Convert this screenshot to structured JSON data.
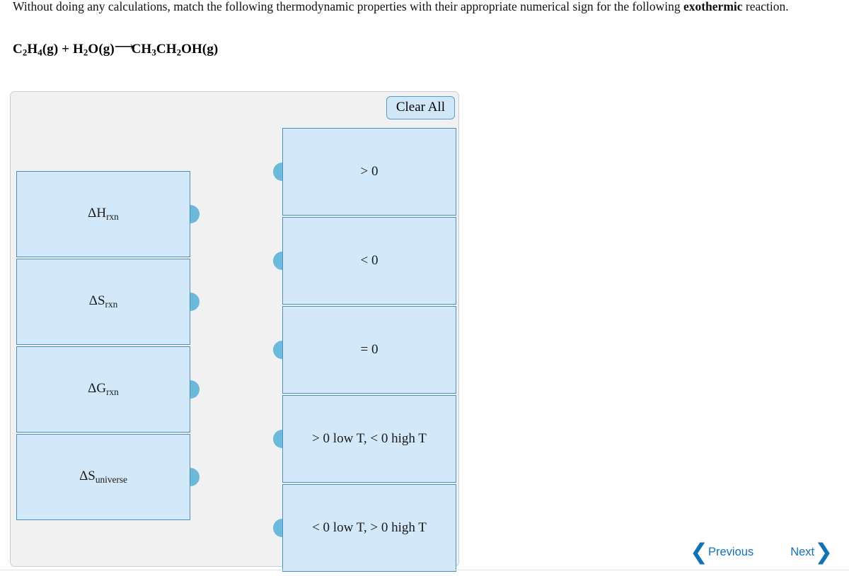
{
  "question": {
    "prompt_part1": "Without doing any calculations, match the following thermodynamic properties with their appropriate numerical sign for the following ",
    "prompt_emphasis": "exothermic",
    "prompt_part2": " reaction.",
    "equation_plain": "C2H4(g) + H2O(g)⟶CH3CH2OH(g)",
    "equation": {
      "reactant1": {
        "c": "C",
        "c_sub": "2",
        "h": "H",
        "h_sub": "4",
        "state": "(g)"
      },
      "plus": "+",
      "reactant2": {
        "h": "H",
        "h_sub": "2",
        "o": "O",
        "state": "(g)"
      },
      "arrow": "⟶",
      "product": {
        "ch3": "CH",
        "ch3_sub": "3",
        "ch2": "CH",
        "ch2_sub": "2",
        "oh": "OH",
        "state": "(g)"
      }
    }
  },
  "panel": {
    "clear_all_label": "Clear All",
    "left_items": [
      {
        "id": "delta-h-rxn",
        "symbol": "ΔH",
        "subscript": "rxn",
        "plain": "ΔHrxn"
      },
      {
        "id": "delta-s-rxn",
        "symbol": "ΔS",
        "subscript": "rxn",
        "plain": "ΔSrxn"
      },
      {
        "id": "delta-g-rxn",
        "symbol": "ΔG",
        "subscript": "rxn",
        "plain": "ΔGrxn"
      },
      {
        "id": "delta-s-universe",
        "symbol": "ΔS",
        "subscript": "universe",
        "plain": "ΔSuniverse"
      }
    ],
    "right_items": [
      {
        "id": "greater-than-zero",
        "label": "> 0"
      },
      {
        "id": "less-than-zero",
        "label": "< 0"
      },
      {
        "id": "equal-zero",
        "label": "= 0"
      },
      {
        "id": "pos-low-neg-high",
        "label": "> 0 low T, < 0 high T"
      },
      {
        "id": "neg-low-pos-high",
        "label": "< 0 low T, > 0 high T"
      }
    ]
  },
  "navigation": {
    "previous_label": "Previous",
    "next_label": "Next",
    "previous_chevron": "❮",
    "next_chevron": "❯"
  },
  "colors": {
    "panel_background": "#f1f1f1",
    "panel_border": "#c9ced6",
    "item_fill": "#d3e8f8",
    "item_border": "#4a90b9",
    "knob": "#6cb9dc",
    "button_fill": "#cfe7f7",
    "button_border": "#5b9bc4",
    "nav_link": "#1272b5"
  }
}
